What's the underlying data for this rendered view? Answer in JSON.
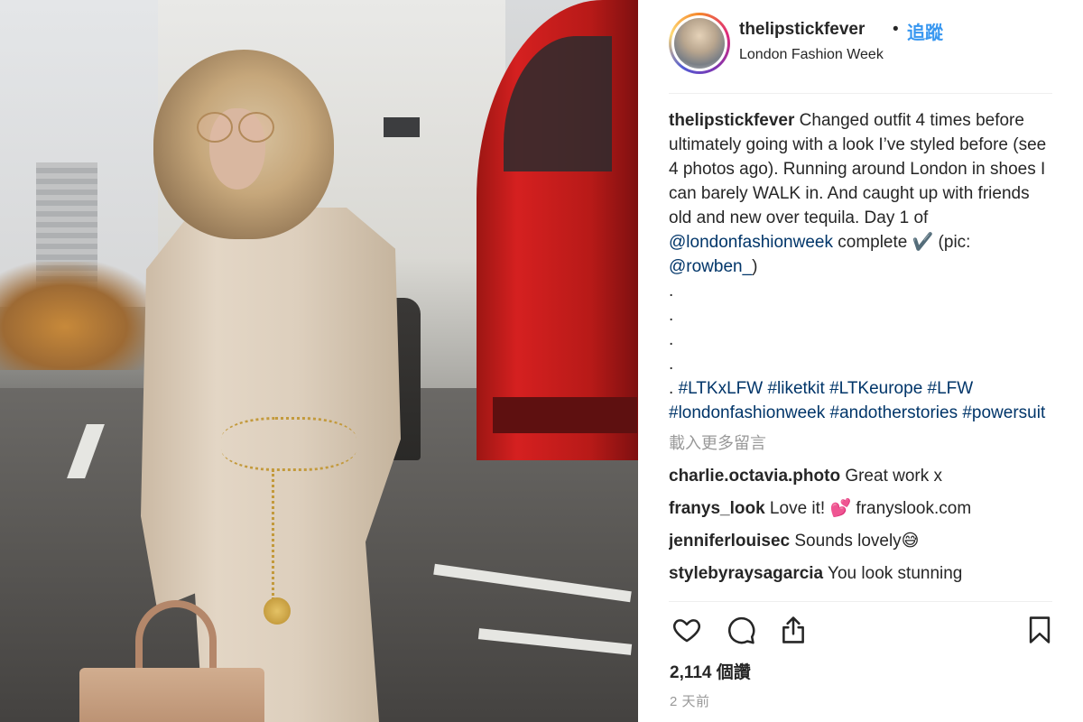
{
  "post": {
    "username": "thelipstickfever",
    "separator": "•",
    "follow_label": "追蹤",
    "location": "London Fashion Week"
  },
  "caption": {
    "username": "thelipstickfever",
    "text_1": " Changed outfit 4 times before ultimately going with a look I’ve styled before (see 4 photos ago). Running around London in shoes I can barely WALK in. And caught up with friends old and new over tequila. Day 1 of ",
    "mention_1": "@londonfashionweek",
    "text_2": " complete ✔️  (pic: ",
    "mention_2": "@rowben_",
    "text_3": ")",
    "dots": [
      ".",
      ".",
      ".",
      "."
    ],
    "hashtag_lead": ". ",
    "hashtags": [
      "#LTKxLFW",
      "#liketkit",
      "#LTKeurope",
      "#LFW",
      "#londonfashionweek",
      "#andotherstories",
      "#powersuit"
    ]
  },
  "load_more_label": "載入更多留言",
  "comments": [
    {
      "user": "charlie.octavia.photo",
      "text": " Great work x"
    },
    {
      "user": "franys_look",
      "text": " Love it! 💕  franyslook.com"
    },
    {
      "user": "jenniferlouisec",
      "text": " Sounds lovely😅"
    },
    {
      "user": "stylebyraysagarcia",
      "text": " You look stunning"
    }
  ],
  "icons": {
    "like": "heart-icon",
    "comment": "comment-bubble-icon",
    "share": "share-icon",
    "save": "bookmark-icon"
  },
  "likes_label": "2,114 個讚",
  "time_label": "2 天前",
  "colors": {
    "link": "#003569",
    "follow": "#3897f0",
    "muted": "#999999",
    "text": "#262626"
  }
}
